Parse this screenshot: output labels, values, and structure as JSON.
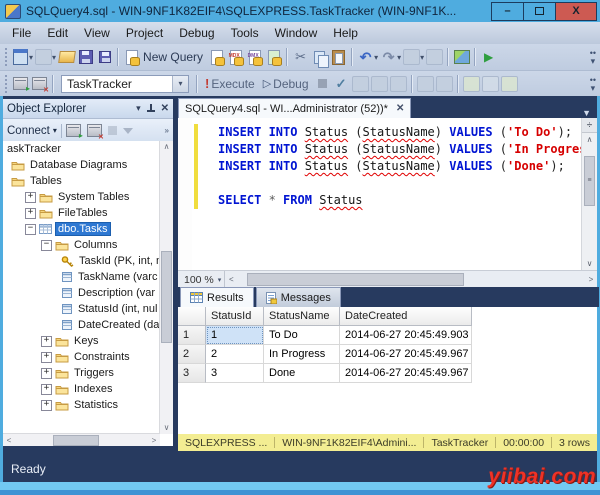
{
  "window": {
    "title": "SQLQuery4.sql - WIN-9NF1K82EIF4\\SQLEXPRESS.TaskTracker (WIN-9NF1K...",
    "minimize": "–",
    "maximize": "",
    "close": "X"
  },
  "menu": {
    "items": [
      "File",
      "Edit",
      "View",
      "Project",
      "Debug",
      "Tools",
      "Window",
      "Help"
    ]
  },
  "toolbar1": {
    "new_query_label": "New Query"
  },
  "toolbar2": {
    "database_combo": "TaskTracker",
    "execute_label": "Execute",
    "debug_label": "Debug"
  },
  "object_explorer": {
    "title": "Object Explorer",
    "connect_label": "Connect",
    "tree": [
      {
        "label": "askTracker",
        "level": 0,
        "icon": "none",
        "expander": "",
        "selected": false
      },
      {
        "label": "Database Diagrams",
        "level": 1,
        "icon": "folder",
        "expander": "",
        "selected": false
      },
      {
        "label": "Tables",
        "level": 1,
        "icon": "folder",
        "expander": "",
        "selected": false
      },
      {
        "label": "System Tables",
        "level": 2,
        "icon": "folder",
        "expander": "plus",
        "selected": false
      },
      {
        "label": "FileTables",
        "level": 2,
        "icon": "folder",
        "expander": "plus",
        "selected": false
      },
      {
        "label": "dbo.Tasks",
        "level": 2,
        "icon": "table",
        "expander": "minus",
        "selected": true
      },
      {
        "label": "Columns",
        "level": 3,
        "icon": "folder",
        "expander": "minus",
        "selected": false
      },
      {
        "label": "TaskId (PK, int, n",
        "level": 4,
        "icon": "key",
        "expander": "",
        "selected": false
      },
      {
        "label": "TaskName (varc",
        "level": 4,
        "icon": "column",
        "expander": "",
        "selected": false
      },
      {
        "label": "Description (var",
        "level": 4,
        "icon": "column",
        "expander": "",
        "selected": false
      },
      {
        "label": "StatusId (int, nul",
        "level": 4,
        "icon": "column",
        "expander": "",
        "selected": false
      },
      {
        "label": "DateCreated (da",
        "level": 4,
        "icon": "column",
        "expander": "",
        "selected": false
      },
      {
        "label": "Keys",
        "level": 3,
        "icon": "folder",
        "expander": "plus",
        "selected": false
      },
      {
        "label": "Constraints",
        "level": 3,
        "icon": "folder",
        "expander": "plus",
        "selected": false
      },
      {
        "label": "Triggers",
        "level": 3,
        "icon": "folder",
        "expander": "plus",
        "selected": false
      },
      {
        "label": "Indexes",
        "level": 3,
        "icon": "folder",
        "expander": "plus",
        "selected": false
      },
      {
        "label": "Statistics",
        "level": 3,
        "icon": "folder",
        "expander": "plus",
        "selected": false
      }
    ]
  },
  "editor": {
    "tab_title": "SQLQuery4.sql - WI...Administrator (52))*",
    "zoom_level": "100 %",
    "lines": [
      {
        "tokens": [
          [
            "kw",
            "INSERT INTO "
          ],
          [
            "err",
            "Status"
          ],
          [
            "pl",
            " ("
          ],
          [
            "err",
            "StatusName"
          ],
          [
            "pl",
            ") "
          ],
          [
            "kw",
            "VALUES"
          ],
          [
            "pl",
            " ("
          ],
          [
            "str",
            "'To Do'"
          ],
          [
            "pl",
            ");"
          ]
        ]
      },
      {
        "tokens": [
          [
            "kw",
            "INSERT INTO "
          ],
          [
            "err",
            "Status"
          ],
          [
            "pl",
            " ("
          ],
          [
            "err",
            "StatusName"
          ],
          [
            "pl",
            ") "
          ],
          [
            "kw",
            "VALUES"
          ],
          [
            "pl",
            " ("
          ],
          [
            "str",
            "'In Progress'"
          ],
          [
            "pl",
            ")"
          ]
        ]
      },
      {
        "tokens": [
          [
            "kw",
            "INSERT INTO "
          ],
          [
            "err",
            "Status"
          ],
          [
            "pl",
            " ("
          ],
          [
            "err",
            "StatusName"
          ],
          [
            "pl",
            ") "
          ],
          [
            "kw",
            "VALUES"
          ],
          [
            "pl",
            " ("
          ],
          [
            "str",
            "'Done'"
          ],
          [
            "pl",
            ");"
          ]
        ]
      },
      {
        "tokens": []
      },
      {
        "tokens": [
          [
            "kw",
            "SELECT"
          ],
          [
            "op",
            " * "
          ],
          [
            "kw",
            "FROM"
          ],
          [
            "pl",
            " "
          ],
          [
            "err",
            "Status"
          ]
        ]
      }
    ]
  },
  "results": {
    "tabs": [
      "Results",
      "Messages"
    ],
    "columns": [
      "StatusId",
      "StatusName",
      "DateCreated"
    ],
    "rows": [
      [
        "1",
        "To Do",
        "2014-06-27 20:45:49.903"
      ],
      [
        "2",
        "In Progress",
        "2014-06-27 20:45:49.967"
      ],
      [
        "3",
        "Done",
        "2014-06-27 20:45:49.967"
      ]
    ],
    "selected_cell": {
      "row": 0,
      "col": 0
    },
    "status_segments": [
      "SQLEXPRESS ...",
      "WIN-9NF1K82EIF4\\Admini...",
      "TaskTracker",
      "00:00:00",
      "3 rows"
    ]
  },
  "statusbar": {
    "ready": "Ready"
  },
  "watermark": "yiibai.com",
  "colors": {
    "frame": "#4facdf",
    "main_bg": "#273a5f",
    "keyword": "#0014d2",
    "string": "#d60000",
    "selection": "#2e78d2",
    "results_statusbar": "#f3ed92",
    "close_button": "#cd5a52"
  }
}
